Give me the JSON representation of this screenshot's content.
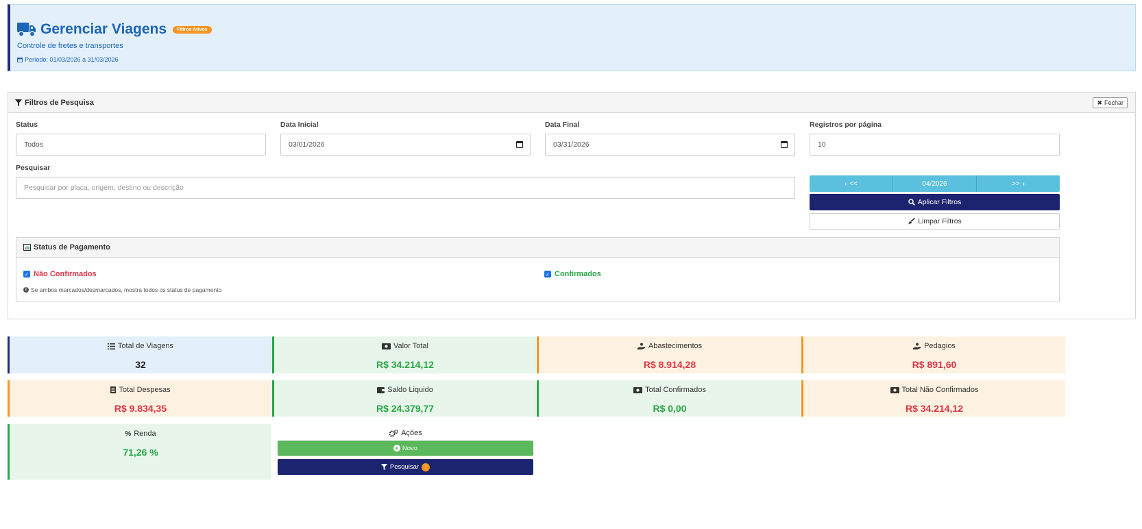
{
  "header": {
    "title": "Gerenciar Viagens",
    "badge": "Filtros Ativos",
    "subtitle": "Controle de fretes e transportes",
    "period": "Período: 01/03/2026 a 31/03/2026"
  },
  "filters": {
    "panel_title": "Filtros de Pesquisa",
    "close_label": "Fechar",
    "status_label": "Status",
    "status_value": "Todos",
    "date_start_label": "Data Inicial",
    "date_start_value": "03/01/2026",
    "date_end_label": "Data Final",
    "date_end_value": "03/31/2026",
    "per_page_label": "Registros por página",
    "per_page_value": "10",
    "search_label": "Pesquisar",
    "search_placeholder": "Pesquisar por placa, origem, destino ou descrição",
    "nav_prev": "<<",
    "nav_month": "04/2026",
    "nav_next": ">>",
    "apply_label": "Aplicar Filtros",
    "clear_label": "Limpar Filtros"
  },
  "payment_status": {
    "title": "Status de Pagamento",
    "not_confirmed_label": "Não Confirmados",
    "confirmed_label": "Confirmados",
    "hint": "Se ambos marcados/desmarcados, mostra todos os status de pagamento"
  },
  "stats": {
    "total_trips_label": "Total de Viagens",
    "total_trips_value": "32",
    "total_value_label": "Valor Total",
    "total_value_value": "R$ 34.214,12",
    "fuel_label": "Abastecimentos",
    "fuel_value": "R$ 8.914,28",
    "tolls_label": "Pedagios",
    "tolls_value": "R$ 891,60",
    "expenses_label": "Total Despesas",
    "expenses_value": "R$ 9.834,35",
    "net_label": "Saldo Liquido",
    "net_value": "R$ 24.379,77",
    "confirmed_label": "Total Confirmados",
    "confirmed_value": "R$ 0,00",
    "not_confirmed_label": "Total Não Confirmados",
    "not_confirmed_value": "R$ 34.214,12",
    "yield_label": "Renda",
    "yield_value": "71,26 %"
  },
  "actions": {
    "label": "Ações",
    "new_label": "Novo",
    "search_label": "Pesquisar",
    "search_badge": "!"
  },
  "colors": {
    "primary": "#1b64b8",
    "navy": "#1c2470",
    "green": "#28a745",
    "red": "#dc3545",
    "orange": "#f7931e",
    "info": "#5bc0de"
  }
}
